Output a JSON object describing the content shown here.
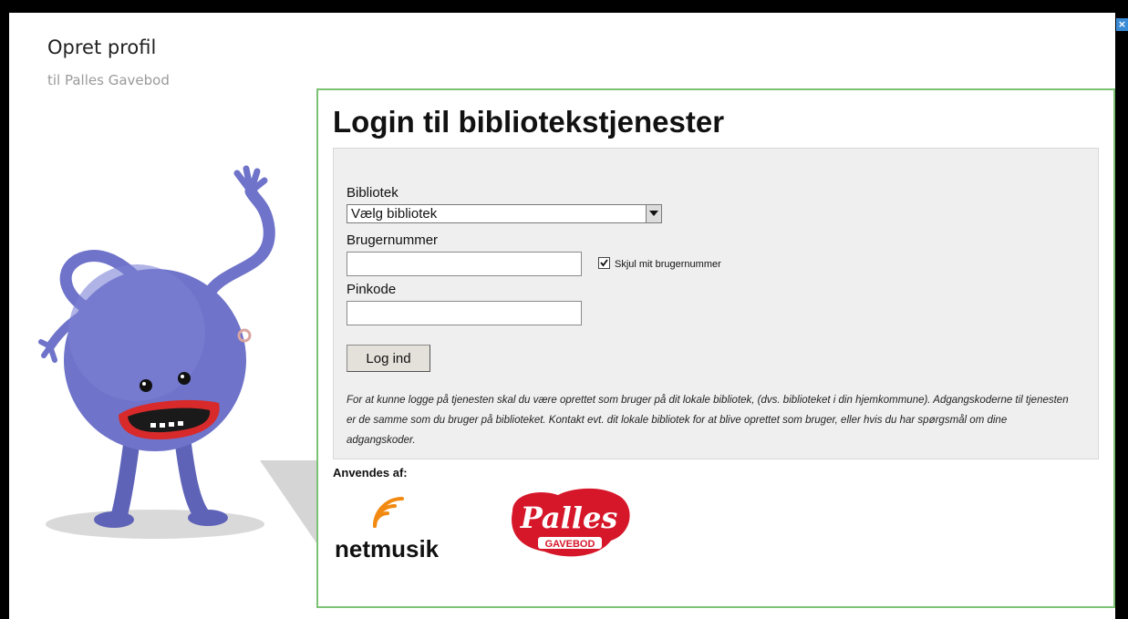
{
  "dialog": {
    "title": "Opret profil",
    "subtitle": "til Palles Gavebod",
    "close_label": "×"
  },
  "panel": {
    "heading": "Login til bibliotekstjenester",
    "library_label": "Bibliotek",
    "library_select_value": "Vælg bibliotek",
    "user_number_label": "Brugernummer",
    "user_number_value": "",
    "hide_number_label": "Skjul mit brugernummer",
    "hide_number_checked": true,
    "pin_label": "Pinkode",
    "pin_value": "",
    "login_button": "Log ind",
    "info_text": "For at kunne logge på tjenesten skal du være oprettet som bruger på dit lokale bibliotek, (dvs. biblioteket i din hjemkommune). Adgangskoderne til tjenesten er de samme som du bruger på biblioteket. Kontakt evt. dit lokale bibliotek for at blive oprettet som bruger, eller hvis du har spørgsmål om dine adgangskoder.",
    "used_by_label": "Anvendes af:"
  },
  "logos": {
    "netmusik": "netmusik",
    "palles_script": "Palles",
    "palles_sub": "GAVEBOD"
  },
  "colors": {
    "panel_border": "#7cc274",
    "close_button": "#3a8bd6",
    "palles_red": "#d6172a",
    "netmusik_orange": "#f28a12",
    "mascot_body": "#6f73c9"
  }
}
